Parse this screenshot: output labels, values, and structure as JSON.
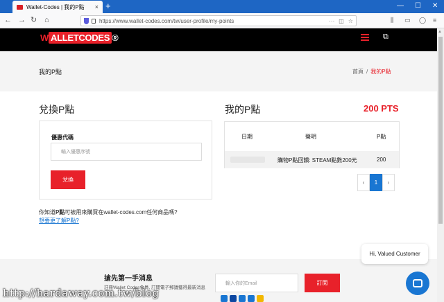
{
  "browser": {
    "tab_title": "Wallet-Codes | 我的P點",
    "tab_close": "×",
    "new_tab": "+",
    "url": "https://www.wallet-codes.com/tw/user-profile/my-points",
    "win_min": "—",
    "win_max": "☐",
    "win_close": "✕"
  },
  "site": {
    "logo_w": "W",
    "logo_mid": "ALLETCODES",
    "logo_suffix": "®"
  },
  "breadcrumb": {
    "page_title": "我的P點",
    "home": "首頁",
    "sep": "/",
    "current": "我的P點"
  },
  "redeem": {
    "heading": "兌換P點",
    "code_label": "優惠代碼",
    "code_placeholder": "輸入優惠序號",
    "submit": "兌換",
    "hint_prefix": "你知道",
    "hint_bold": "P點",
    "hint_suffix": "可被用來購買在wallet-codes.com任何商品嗎?",
    "learn_more": "想要更了解P點?"
  },
  "points": {
    "heading": "我的P點",
    "total": "200 PTS",
    "columns": [
      "日期",
      "聲明",
      "P點"
    ],
    "rows": [
      {
        "date": "",
        "statement": "購物P點回饋: STEAM點數200元",
        "points": "200"
      }
    ],
    "pager": {
      "prev": "‹",
      "page": "1",
      "next": "›"
    }
  },
  "subscribe": {
    "title": "搶先第一手消息",
    "desc": "註冊Wallet Codes會員, 訂閱電子郵議獲得最新消息",
    "email_placeholder": "輸入你的Email",
    "button": "訂閱"
  },
  "chat": {
    "greeting": "Hi, Valued Customer"
  },
  "watermark": "http://hardaway.com.tw/blog"
}
